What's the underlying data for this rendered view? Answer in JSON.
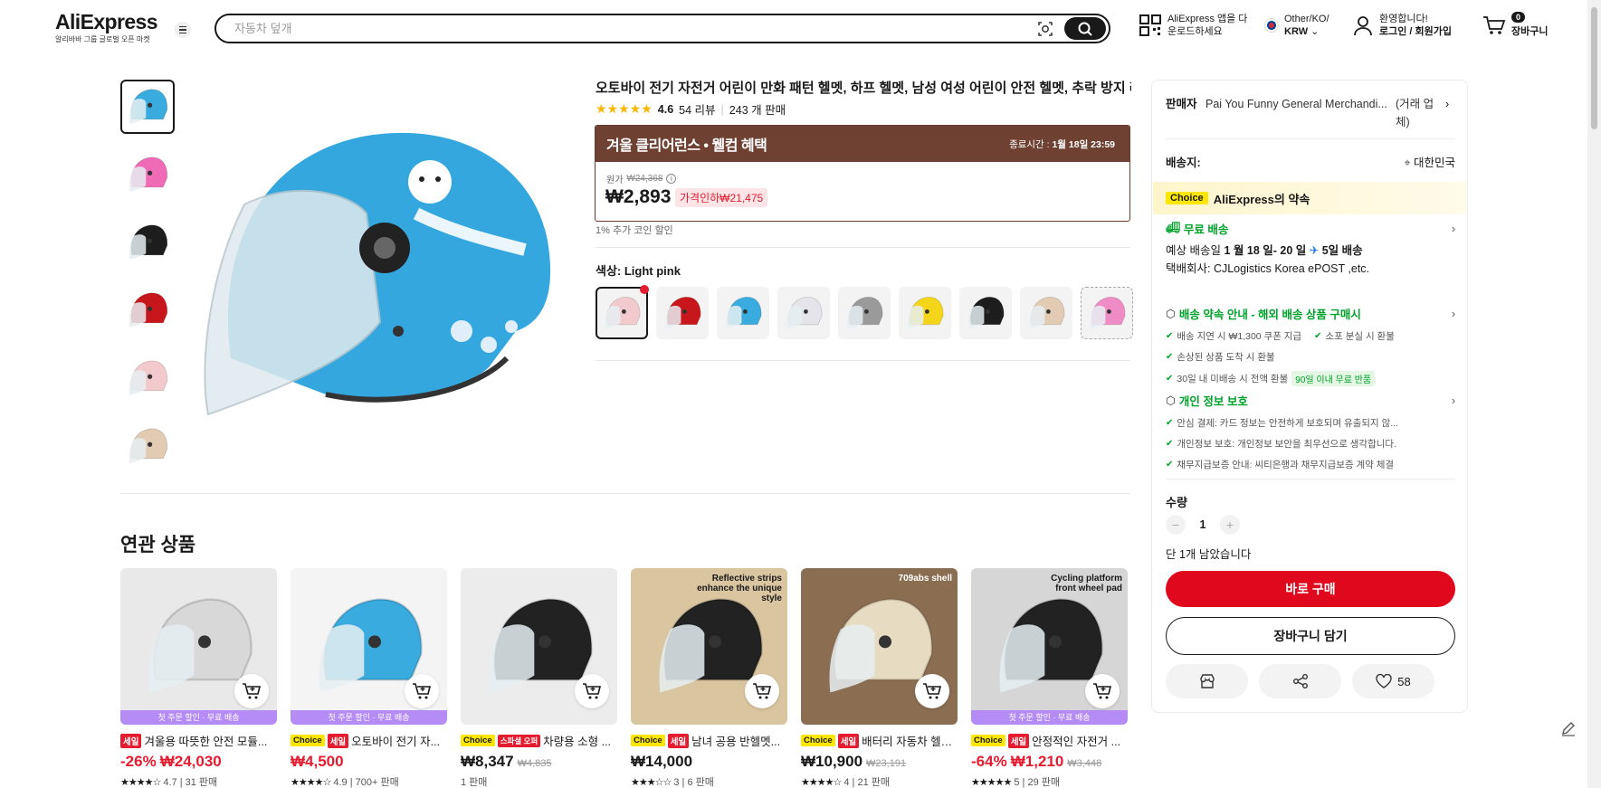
{
  "header": {
    "logo": "AliExpress",
    "logo_sub": "알리바바 그룹 글로벌 오픈 마켓",
    "search_placeholder": "자동차 덮개",
    "app_line1": "AliExpress 앱을 다",
    "app_line2": "운로드하세요",
    "lang_line1": "Other/KO/",
    "lang_line2": "KRW",
    "account_line1": "환영합니다!",
    "account_line2": "로그인 / 회원가입",
    "cart_count": "0",
    "cart_label": "장바구니"
  },
  "product": {
    "title": "오토바이 전기 자전거 어린이 만화 패턴 헬멧, 하프 헬멧, 남성 여성 어린이 안전 헬멧, 추락 방지 러블리",
    "rating": "4.6",
    "reviews": "54 리뷰",
    "sold": "243 개 판매",
    "promo_title": "겨울 클리어런스 • 웰컴 혜택",
    "promo_time_label": "종료시간 :",
    "promo_time": "1월 18일 23:59",
    "orig_label": "원가",
    "orig_price": "₩24,368",
    "price": "₩2,893",
    "discount": "가격인하₩21,475",
    "coin": "1% 추가 코인 할인",
    "color_label": "색상: Light pink"
  },
  "swatches": [
    {
      "color": "#f2c9cc"
    },
    {
      "color": "#c8171c"
    },
    {
      "color": "#3aabdf"
    },
    {
      "color": "#e4e4ea"
    },
    {
      "color": "#9a9a9a"
    },
    {
      "color": "#f4d51a"
    },
    {
      "color": "#1d1d1d"
    },
    {
      "color": "#e1cbb2"
    },
    {
      "color": "#f08cc5"
    }
  ],
  "thumb_colors": [
    "#3aabdf",
    "#f06bb5",
    "#1d1d1d",
    "#c8171c",
    "#f2c9cc",
    "#e1cbb2"
  ],
  "related": {
    "title": "연관 상품",
    "items": [
      {
        "banner": "첫 주문 할인 · 무료 배송",
        "tags": [
          "세일"
        ],
        "name": "겨울용 따뜻한 안전 모듈...",
        "price_prefix": "-26%",
        "price": "₩24,030",
        "old": "",
        "red": true,
        "stars": "★★★★☆",
        "meta": "4.7 | 31 판매",
        "img": "#e9e9e9",
        "helmet": "#d8d8d8"
      },
      {
        "banner": "첫 주문 할인 · 무료 배송",
        "tags": [
          "Choice",
          "세일"
        ],
        "name": "오토바이 전기 자...",
        "price_prefix": "",
        "price": "₩4,500",
        "old": "",
        "red": true,
        "stars": "★★★★☆",
        "meta": "4.9 | 700+ 판매",
        "img": "#f4f4f4",
        "helmet": "#3aabdf"
      },
      {
        "banner": "",
        "tags": [
          "Choice",
          "스파셜 오퍼"
        ],
        "name": "차량용 소형 ...",
        "price_prefix": "",
        "price": "₩8,347",
        "old": "₩4,835",
        "red": false,
        "stars": "",
        "meta": "1 판매",
        "img": "#ececec",
        "helmet": "#222"
      },
      {
        "banner": "",
        "tags": [
          "Choice",
          "세일"
        ],
        "name": "남녀 공용 반헬멧...",
        "price_prefix": "",
        "price": "₩14,000",
        "old": "",
        "red": false,
        "stars": "★★★☆☆",
        "meta": "3 | 6 판매",
        "img": "#d9c59f",
        "helmet": "#222"
      },
      {
        "banner": "",
        "tags": [
          "Choice",
          "세일"
        ],
        "name": "배터리 자동차 헬멧 전...",
        "price_prefix": "",
        "price": "₩10,900",
        "old": "₩23,191",
        "red": false,
        "stars": "★★★★☆",
        "meta": "4 | 21 판매",
        "img": "#8b6e52",
        "helmet": "#e7dcc2"
      },
      {
        "banner": "첫 주문 할인 · 무료 배송",
        "tags": [
          "Choice",
          "세일"
        ],
        "name": "안정적인 자전거 ...",
        "price_prefix": "-64%",
        "price": "₩1,210",
        "old": "₩3,448",
        "red": true,
        "stars": "★★★★★",
        "meta": "5 | 29 판매",
        "img": "#d6d6d6",
        "helmet": "#222"
      }
    ],
    "img_texts": [
      "",
      "",
      "",
      "Reflective strips enhance the unique style",
      "709abs shell",
      "Cycling platform front wheel pad"
    ]
  },
  "panel": {
    "seller_label": "판매자",
    "seller_name": "Pai You Funny General Merchandi...",
    "seller_type": "(거래 업체)",
    "ship_label": "배송지:",
    "ship_country": "대한민국",
    "choice_badge": "Choice",
    "choice_title": "AliExpress의 약속",
    "free_ship": "무료 배송",
    "est_prefix": "예상 배송일",
    "est_dates": "1 월 18 일- 20 일",
    "est_days": "5일 배송",
    "carrier": "택배회사: CJLogistics Korea ePOST ,etc.",
    "guarantee_title": "배송 약속 안내 - 해외 배송 상품 구매시",
    "g1": "배송 지연 시 ₩1,300 쿠폰 지급",
    "g2": "소포 분실 시 환불",
    "g3": "손상된 상품 도착 시 환불",
    "g4": "30일 내 미배송 시 전액 환불",
    "g4_tag": "90일 이내 무료 반품",
    "privacy_title": "개인 정보 보호",
    "p1": "안심 결제: 카드 정보는 안전하게 보호되며 유출되지 않...",
    "p2": "개인정보 보호: 개인정보 보안을 최우선으로 생각합니다.",
    "p3": "채무지급보증 안내: 씨티은행과 채무지급보증 계약 체결",
    "qty_label": "수량",
    "qty_value": "1",
    "stock": "단 1개 남았습니다",
    "buy_now": "바로 구매",
    "add_cart": "장바구니 담기",
    "wish_count": "58"
  }
}
